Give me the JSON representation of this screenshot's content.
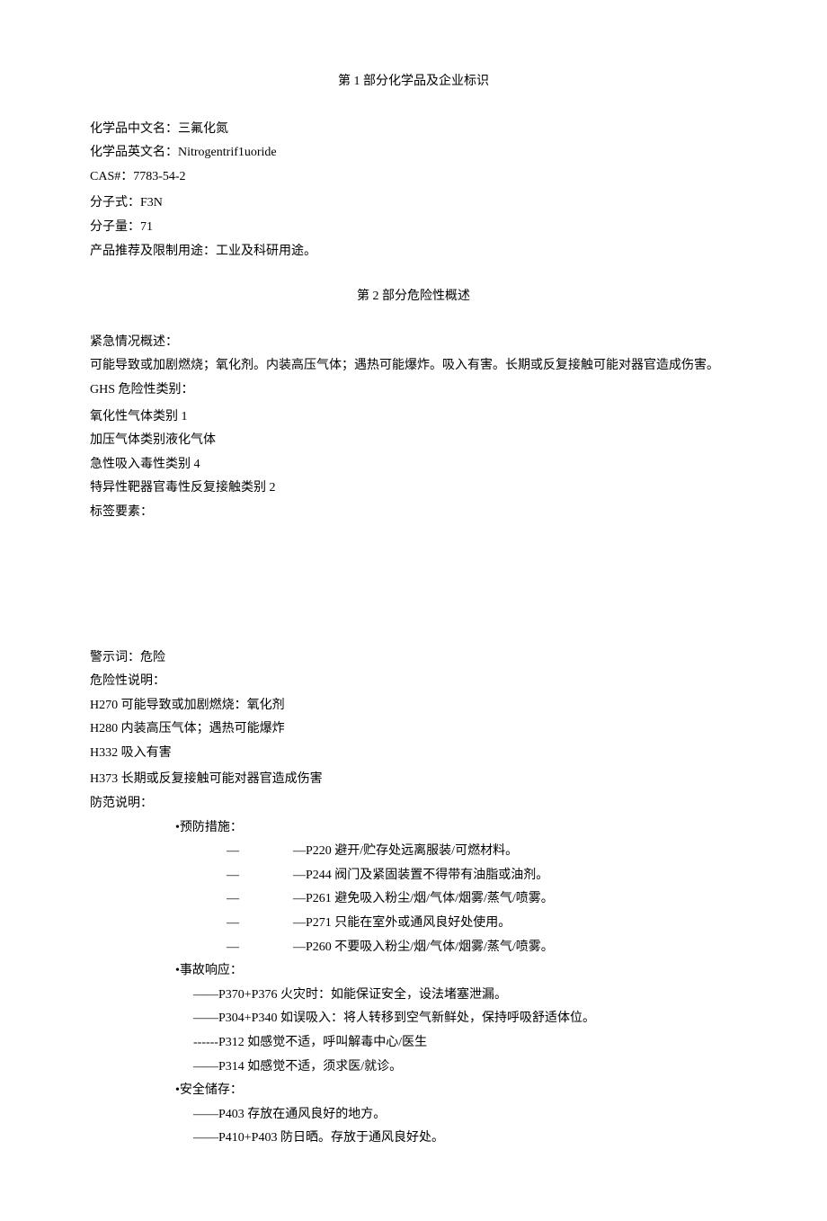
{
  "section1": {
    "title": "第 1 部分化学品及企业标识",
    "fields": {
      "name_cn_label": "化学品中文名：",
      "name_cn_value": "三氟化氮",
      "name_en_label": "化学品英文名：",
      "name_en_value": "Nitrogentrif1uoride",
      "cas_label": "CAS#：",
      "cas_value": "7783-54-2",
      "formula_label": "分子式：",
      "formula_value": "F3N",
      "mw_label": "分子量：",
      "mw_value": "71",
      "usage_label": "产品推荐及限制用途：",
      "usage_value": "工业及科研用途。"
    }
  },
  "section2": {
    "title": "第 2 部分危险性概述",
    "emergency_label": "紧急情况概述：",
    "emergency_text": "可能导致或加剧燃烧；氧化剂。内装高压气体；遇热可能爆炸。吸入有害。长期或反复接触可能对器官造成伤害。",
    "ghs_label": "GHS 危险性类别：",
    "ghs_classes": [
      "氧化性气体类别 1",
      "加压气体类别液化气体",
      "急性吸入毒性类别 4",
      "特异性靶器官毒性反复接触类别 2"
    ],
    "label_elements": "标签要素：",
    "signal_label": "警示词：",
    "signal_value": "危险",
    "hazard_label": "危险性说明：",
    "hazard_statements": [
      "H270 可能导致或加剧燃烧：氧化剂",
      "H280 内装高压气体；遇热可能爆炸",
      "H332 吸入有害",
      "H373 长期或反复接触可能对器官造成伤害"
    ],
    "precaution_label": "防范说明：",
    "prevention_title": "•预防措施：",
    "prevention_items": [
      {
        "prefix": "—",
        "sep": "—",
        "text": "P220 避开/贮存处远离服装/可燃材料。"
      },
      {
        "prefix": "—",
        "sep": "—",
        "text": "P244 阀门及紧固装置不得带有油脂或油剂。"
      },
      {
        "prefix": "—",
        "sep": "—",
        "text": "P261 避免吸入粉尘/烟/气体/烟雾/蒸气/喷雾。"
      },
      {
        "prefix": "—",
        "sep": "—",
        "text": "P271 只能在室外或通风良好处使用。"
      },
      {
        "prefix": "—",
        "sep": "—",
        "text": "P260 不要吸入粉尘/烟/气体/烟雾/蒸气/喷雾。"
      }
    ],
    "response_title": "•事故响应：",
    "response_items": [
      "——P370+P376 火灾时：如能保证安全，设法堵塞泄漏。",
      "——P304+P340 如误吸入：将人转移到空气新鲜处，保持呼吸舒适体位。",
      "------P312 如感觉不适，呼叫解毒中心/医生",
      "——P314 如感觉不适，须求医/就诊。"
    ],
    "storage_title": "•安全储存：",
    "storage_items": [
      "——P403 存放在通风良好的地方。",
      "——P410+P403 防日晒。存放于通风良好处。"
    ]
  }
}
